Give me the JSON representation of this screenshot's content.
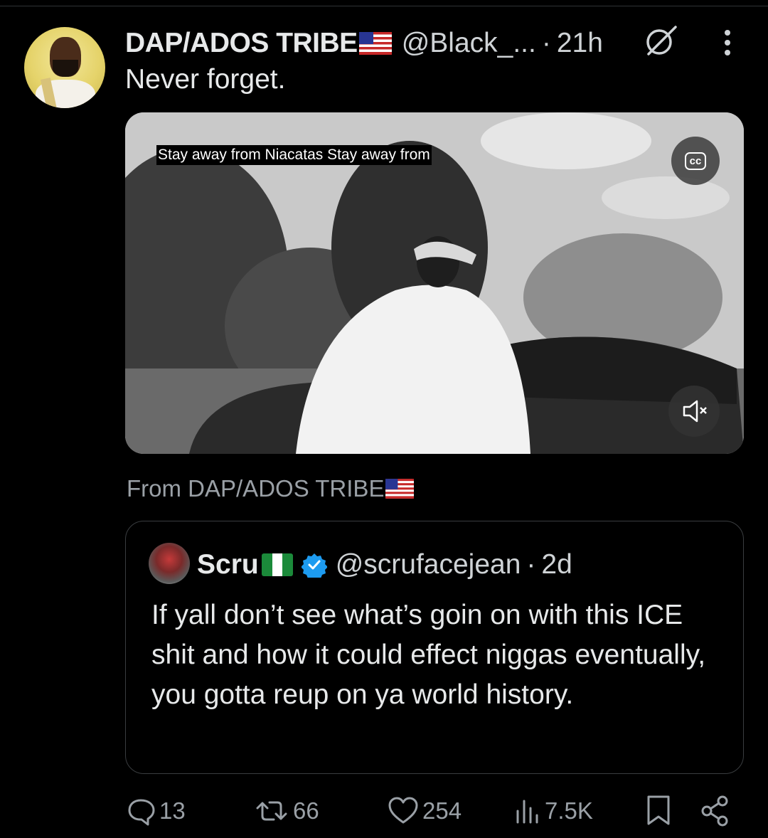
{
  "tweet": {
    "display_name": "DAP/ADOS TRIBE",
    "handle": "@Black_...",
    "separator": "·",
    "time": "21h",
    "text": "Never forget.",
    "from_label": "From DAP/ADOS TRIBE"
  },
  "video": {
    "caption": "Stay away from Niacatas Stay away from",
    "cc_label": "cc"
  },
  "quote": {
    "display_name": "Scru",
    "handle": "@scrufacejean",
    "separator": "·",
    "time": "2d",
    "text": "If yall don’t see what’s goin on with this ICE shit and how it could effect niggas eventually, you gotta reup on ya world history."
  },
  "actions": {
    "replies": "13",
    "reposts": "66",
    "likes": "254",
    "views": "7.5K"
  },
  "icons": [
    "grok-icon",
    "more-icon",
    "cc-icon",
    "mute-icon",
    "verified-icon",
    "reply-icon",
    "repost-icon",
    "like-icon",
    "views-icon",
    "bookmark-icon",
    "share-icon"
  ],
  "colors": {
    "background": "#000000",
    "text": "#e7e9ea",
    "muted": "#9aa0a6",
    "verified": "#1d9bf0"
  }
}
